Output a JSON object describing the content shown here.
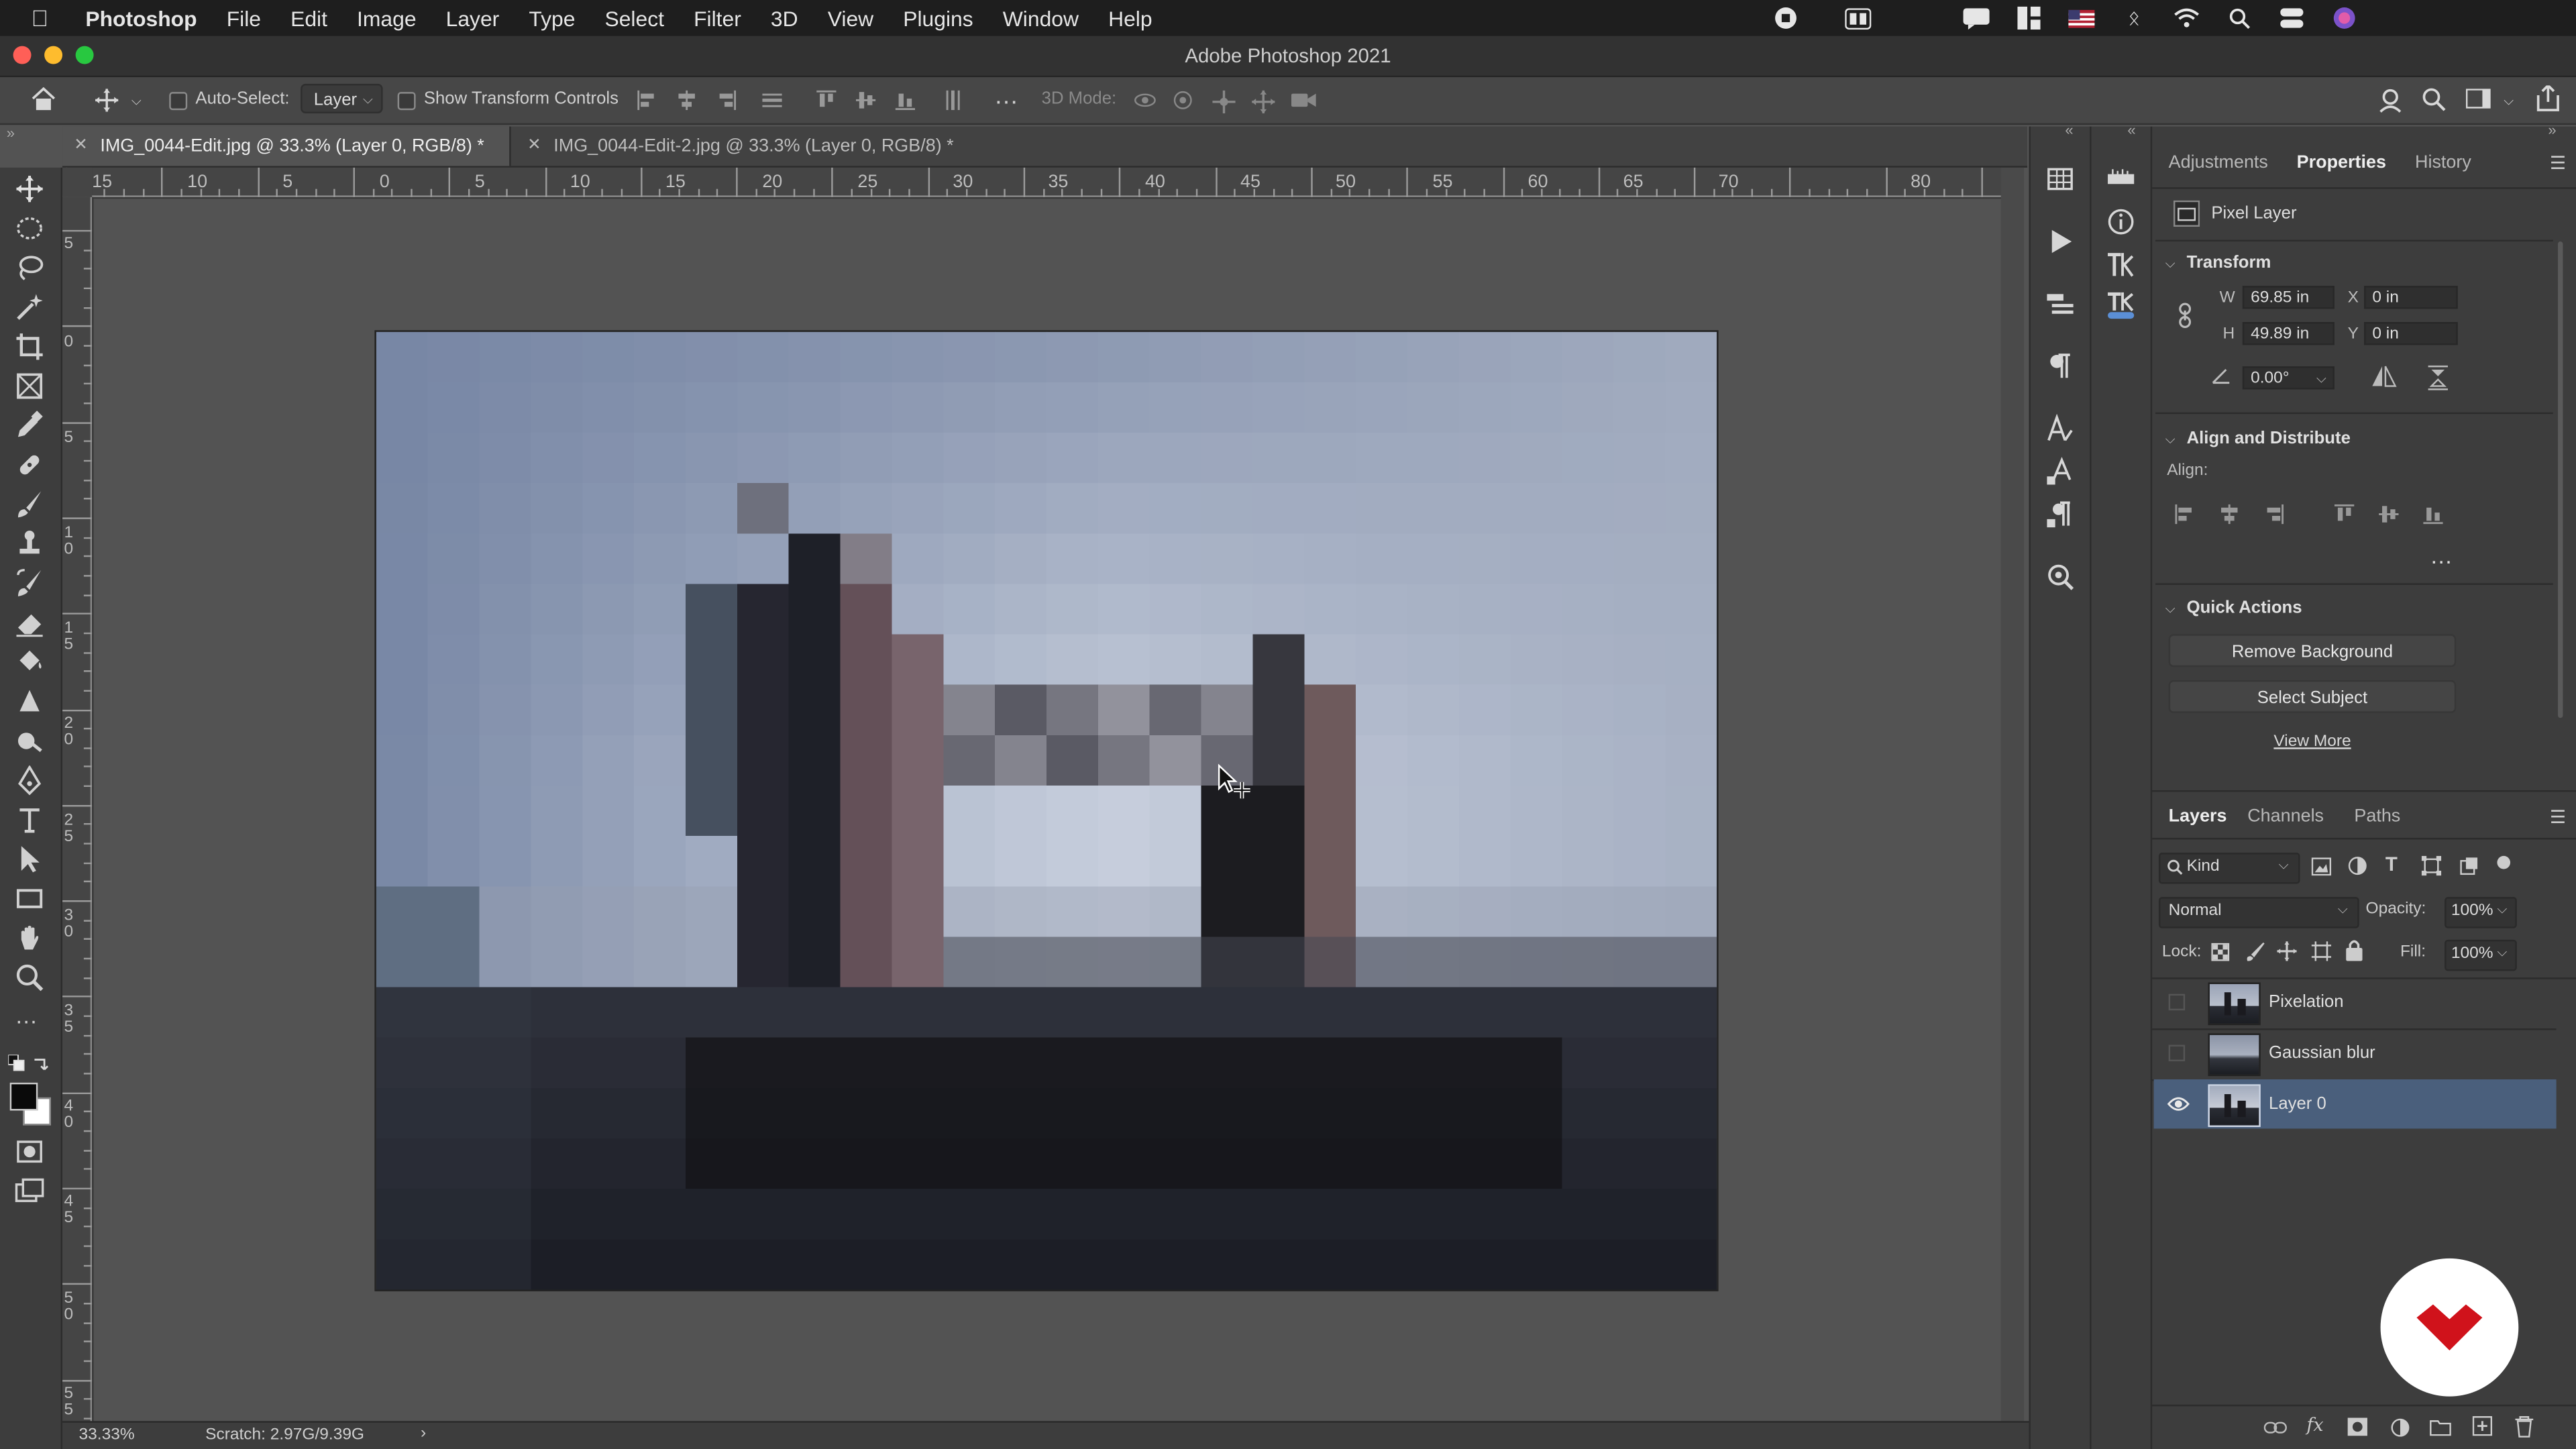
{
  "menubar": {
    "app": "Photoshop",
    "items": [
      "File",
      "Edit",
      "Image",
      "Layer",
      "Type",
      "Select",
      "Filter",
      "3D",
      "View",
      "Plugins",
      "Window",
      "Help"
    ]
  },
  "titlebar": {
    "title": "Adobe Photoshop 2021"
  },
  "options": {
    "auto_select_label": "Auto-Select:",
    "auto_select_value": "Layer",
    "show_transform_label": "Show Transform Controls",
    "mode_3d_label": "3D Mode:"
  },
  "tabs": [
    {
      "label": "IMG_0044-Edit.jpg @ 33.3% (Layer 0, RGB/8) *",
      "active": true
    },
    {
      "label": "IMG_0044-Edit-2.jpg @ 33.3% (Layer 0, RGB/8) *",
      "active": false
    }
  ],
  "ruler": {
    "h_ticks": [
      "15",
      "10",
      "5",
      "0",
      "5",
      "10",
      "15",
      "20",
      "25",
      "30",
      "35",
      "40",
      "45",
      "50",
      "55",
      "60",
      "65",
      "70",
      "80"
    ],
    "v_ticks": [
      "5",
      "0",
      "5",
      "1\n0",
      "1\n5",
      "2\n0",
      "2\n5",
      "3\n0",
      "3\n5",
      "4\n0",
      "4\n5",
      "5\n0",
      "5\n5"
    ]
  },
  "status": {
    "zoom": "33.33%",
    "scratch": "Scratch: 2.97G/9.39G"
  },
  "panels": {
    "top_tabs": [
      "Adjustments",
      "Properties",
      "History"
    ],
    "active_tab": "Properties",
    "pixel_layer_label": "Pixel Layer",
    "transform": {
      "header": "Transform",
      "w_label": "W",
      "w": "69.85 in",
      "x_label": "X",
      "x": "0 in",
      "h_label": "H",
      "h": "49.89 in",
      "y_label": "Y",
      "y": "0 in",
      "angle": "0.00°"
    },
    "align": {
      "header": "Align and Distribute",
      "align_label": "Align:"
    },
    "quick_actions": {
      "header": "Quick Actions",
      "remove_bg": "Remove Background",
      "select_subject": "Select Subject",
      "view_more": "View More"
    },
    "layers_tabs": [
      "Layers",
      "Channels",
      "Paths"
    ],
    "layers_active_tab": "Layers",
    "kind_label": "Kind",
    "blend_mode": "Normal",
    "opacity_label": "Opacity:",
    "opacity": "100%",
    "lock_label": "Lock:",
    "fill_label": "Fill:",
    "fill": "100%",
    "layers": [
      {
        "name": "Pixelation",
        "visible": false,
        "selected": false
      },
      {
        "name": "Gaussian blur",
        "visible": false,
        "selected": false
      },
      {
        "name": "Layer 0",
        "visible": true,
        "selected": true
      }
    ]
  },
  "colors": {
    "accent_selected": "#4a5f7c",
    "logo_red": "#d0121b"
  }
}
